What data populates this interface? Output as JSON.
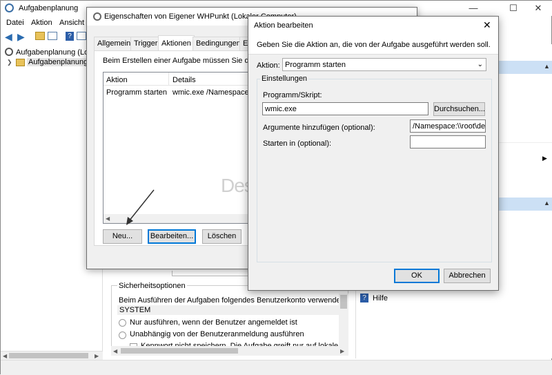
{
  "main_window": {
    "title": "Aufgabenplanung",
    "menu": [
      "Datei",
      "Aktion",
      "Ansicht"
    ],
    "tree": [
      "Aufgabenplanung (Loka",
      "Aufgabenplanungsbi"
    ],
    "right_panel": {
      "help": "Hilfe"
    },
    "security": {
      "group_title": "Sicherheitsoptionen",
      "account_label": "Beim Ausführen der Aufgaben folgendes Benutzerkonto verwenden:",
      "account_value": "SYSTEM",
      "radio_1": "Nur ausführen, wenn der Benutzer angemeldet ist",
      "radio_2": "Unabhängig von der Benutzeranmeldung ausführen",
      "checkbox_1": "Kennwort nicht speichern. Die Aufgabe greift nur auf lokale Ressourc"
    }
  },
  "props_dialog": {
    "title": "Eigenschaften von Eigener WHPunkt (Lokaler Computer)",
    "tabs": [
      "Allgemein",
      "Trigger",
      "Aktionen",
      "Bedingungen",
      "Ei"
    ],
    "description": "Beim Erstellen einer Aufgabe müssen Sie die be",
    "columns": [
      "Aktion",
      "Details"
    ],
    "rows": [
      {
        "aktion": "Programm starten",
        "details": "wmic.exe /Namespace:\\\\r"
      }
    ],
    "buttons": {
      "new": "Neu...",
      "edit": "Bearbeiten...",
      "delete": "Löschen"
    }
  },
  "edit_dialog": {
    "title": "Aktion bearbeiten",
    "description": "Geben Sie die Aktion an, die von der Aufgabe ausgeführt werden soll.",
    "action_label": "Aktion:",
    "action_value": "Programm starten",
    "settings_title": "Einstellungen",
    "program_label": "Programm/Skript:",
    "program_value": "wmic.exe",
    "browse": "Durchsuchen...",
    "args_label": "Argumente hinzufügen (optional):",
    "args_value": "/Namespace:\\\\root\\defa",
    "start_label": "Starten in (optional):",
    "start_value": "",
    "ok": "OK",
    "cancel": "Abbrechen"
  },
  "watermark": "Deskmodder.de",
  "colors": {
    "accent": "#0078d7",
    "panel_header": "#cce0f5",
    "selection": "#cce8ff"
  }
}
